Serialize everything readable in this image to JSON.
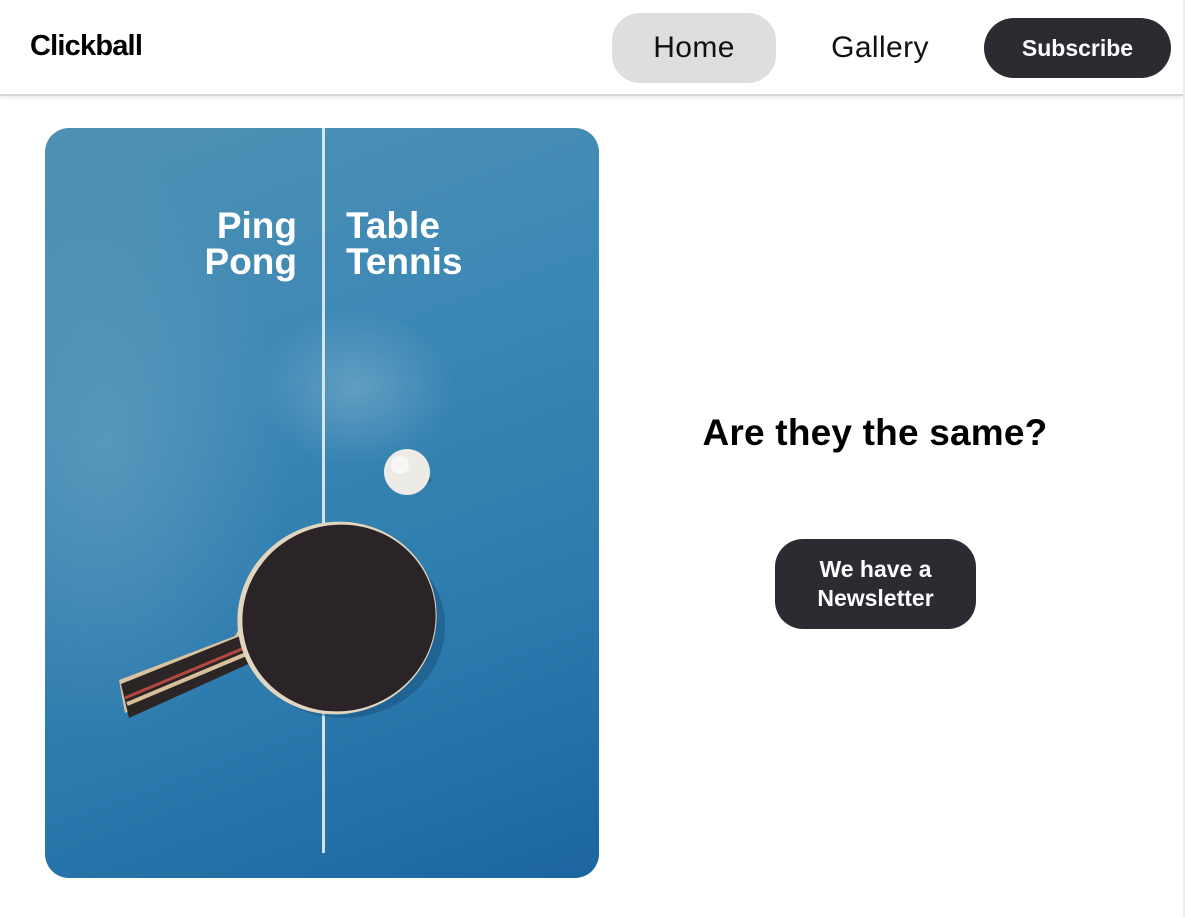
{
  "header": {
    "brand": "Clickball",
    "nav": {
      "home": "Home",
      "gallery": "Gallery"
    },
    "subscribe_label": "Subscribe"
  },
  "hero": {
    "left_text": [
      "Ping",
      "Pong"
    ],
    "right_text": [
      "Table",
      "Tennis"
    ],
    "image_icons": [
      "ping-pong-paddle-icon",
      "ping-pong-ball-icon"
    ]
  },
  "main": {
    "question": "Are they the same?",
    "newsletter_button": [
      "We have a",
      "Newsletter"
    ]
  },
  "colors": {
    "dark_button": "#2b2b32",
    "active_nav": "#dedede",
    "table_blue": "#2b79ad",
    "paddle_rubber": "#2a2428"
  }
}
